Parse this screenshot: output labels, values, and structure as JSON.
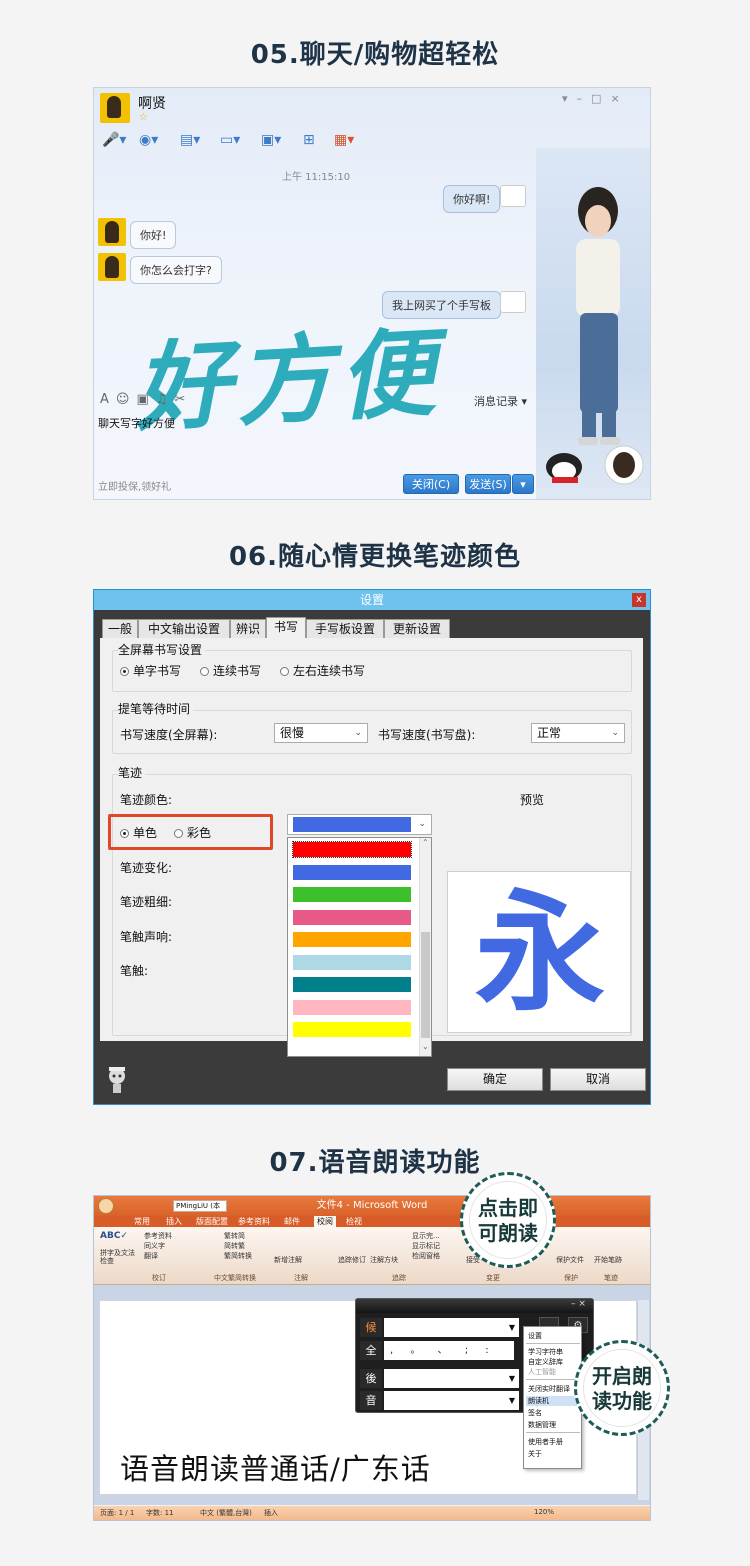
{
  "sections": {
    "chat_title": "05.聊天/购物超轻松",
    "color_title": "06.随心情更换笔迹颜色",
    "voice_title": "07.语音朗读功能"
  },
  "chat": {
    "contact_name": "啊贤",
    "timestamp": "上午 11:15:10",
    "messages": [
      {
        "from": "me",
        "text": "你好啊!"
      },
      {
        "from": "other",
        "text": "你好!"
      },
      {
        "from": "other",
        "text": "你怎么会打字?"
      },
      {
        "from": "me",
        "text": "我上网买了个手写板"
      }
    ],
    "handwriting": "好方便",
    "input_text": "聊天写字好方便",
    "history_label": "消息记录",
    "footer_link": "立即投保,领好礼",
    "close_button": "关闭(C)",
    "send_button": "发送(S)",
    "window_controls": [
      "▾",
      "–",
      "□",
      "×"
    ]
  },
  "settings": {
    "window_title": "设置",
    "close": "x",
    "tabs": [
      "一般",
      "中文输出设置",
      "辨识",
      "书写",
      "手写板设置",
      "更新设置"
    ],
    "active_tab": "书写",
    "fullscreen_group": "全屏幕书写设置",
    "fullscreen_options": [
      "单字书写",
      "连续书写",
      "左右连续书写"
    ],
    "wait_group": "提笔等待时间",
    "speed_fullscreen_label": "书写速度(全屏幕):",
    "speed_fullscreen_value": "很慢",
    "speed_pad_label": "书写速度(书写盘):",
    "speed_pad_value": "正常",
    "stroke_group": "笔迹",
    "stroke_color_label": "笔迹颜色:",
    "color_modes": [
      "单色",
      "彩色"
    ],
    "preview_label": "预览",
    "stroke_change_label": "笔迹变化:",
    "stroke_width_label": "笔迹粗细:",
    "touch_sound_label": "笔触声响:",
    "touch_label": "笔触:",
    "preview_char": "永",
    "selected_color": "#4169e1",
    "color_options": [
      "#ff0000",
      "#4169e1",
      "#3cbf2a",
      "#e85a86",
      "#ffa500",
      "#add8e6",
      "#00808b",
      "#ffb6c1",
      "#ffff00"
    ],
    "ok_button": "确定",
    "cancel_button": "取消"
  },
  "word": {
    "window_title": "文件4 - Microsoft Word",
    "font_box": "PMingLiU (本",
    "ribbon_tabs": [
      "常用",
      "插入",
      "版面配置",
      "参考资料",
      "邮件",
      "校阅",
      "检视"
    ],
    "ribbon_items": [
      "拼字及文法检查",
      "参考资料",
      "同义字",
      "翻译",
      "繁转简",
      "简转繁",
      "繁简转换",
      "新增注解",
      "追踪修订",
      "注解方块",
      "显示完...",
      "显示标记",
      "检阅窗格",
      "接受",
      "拒绝",
      "保护文件",
      "开始笔跡"
    ],
    "ribbon_groups": [
      "校订",
      "中文繁简转换",
      "注解",
      "追踪",
      "变更",
      "保护",
      "笔迹"
    ],
    "doc_text": "语音朗读普通话/广东话",
    "ime_keys": [
      "候",
      "全",
      "後",
      "音"
    ],
    "ime_punct": ", 。 、 ; : ?",
    "menu_items": [
      "设置",
      "学习字符串",
      "自定义辞库",
      "人工智能",
      "关闭实时翻译",
      "朗读机",
      "签名",
      "数据管理",
      "使用者手册",
      "关于"
    ],
    "status_page": "页面: 1 / 1",
    "status_words": "字数: 11",
    "status_lang": "中文 (繁體,台灣)",
    "status_mode": "插入",
    "zoom": "120%"
  },
  "callouts": {
    "click_read": "点击即可朗读",
    "open_read": "开启朗读功能"
  }
}
